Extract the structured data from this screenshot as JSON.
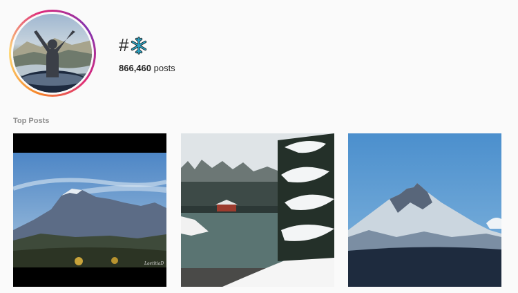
{
  "header": {
    "hashtag_symbol": "#",
    "hashtag_icon": "snowflake-icon",
    "post_count": "866,460",
    "post_count_suffix": " posts"
  },
  "section": {
    "top_posts_label": "Top Posts"
  },
  "posts": [
    {
      "subject": "mountain-range-blue-sky",
      "watermark": "LaetitiaD"
    },
    {
      "subject": "snowy-lake-with-cabin-and-pines"
    },
    {
      "subject": "snow-capped-peak-at-dusk"
    }
  ],
  "colors": {
    "snowflake": "#2aa7c9",
    "ring_gradient": [
      "#f58529",
      "#feda77",
      "#dd2a7b",
      "#8134af"
    ],
    "label_gray": "#8e8e8e"
  }
}
